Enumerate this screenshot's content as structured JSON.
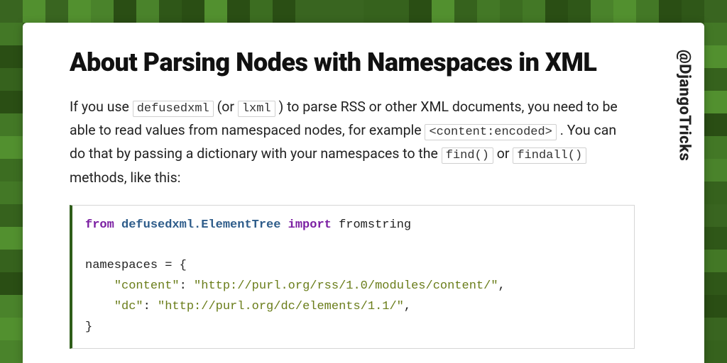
{
  "handle": "@DjangoTricks",
  "title": "About Parsing Nodes with Namespaces in XML",
  "para": {
    "t1": "If you use ",
    "c1": "defusedxml",
    "t2": " (or ",
    "c2": "lxml",
    "t3": " ) to parse RSS or other XML documents, you need to be able to read values from namespaced nodes, for example ",
    "c3": "<content:encoded>",
    "t4": " . You can do that by passing a dictionary with your namespaces to the ",
    "c4": "find()",
    "t5": " or ",
    "c5": "findall()",
    "t6": " methods, like this:"
  },
  "code": {
    "kw_from": "from",
    "module": "defusedxml.ElementTree",
    "kw_import": "import",
    "import_name": " fromstring",
    "line2": "namespaces = {",
    "line3a": "    ",
    "line3b": "\"content\"",
    "line3c": ": ",
    "line3d": "\"http://purl.org/rss/1.0/modules/content/\"",
    "line3e": ",",
    "line4a": "    ",
    "line4b": "\"dc\"",
    "line4c": ": ",
    "line4d": "\"http://purl.org/dc/elements/1.1/\"",
    "line4e": ",",
    "line5": "}"
  },
  "bg_shades": [
    "#2f5718",
    "#36621d",
    "#3c6d21",
    "#437826",
    "#4a832b",
    "#2a4e14",
    "#52902f",
    "#396520"
  ]
}
